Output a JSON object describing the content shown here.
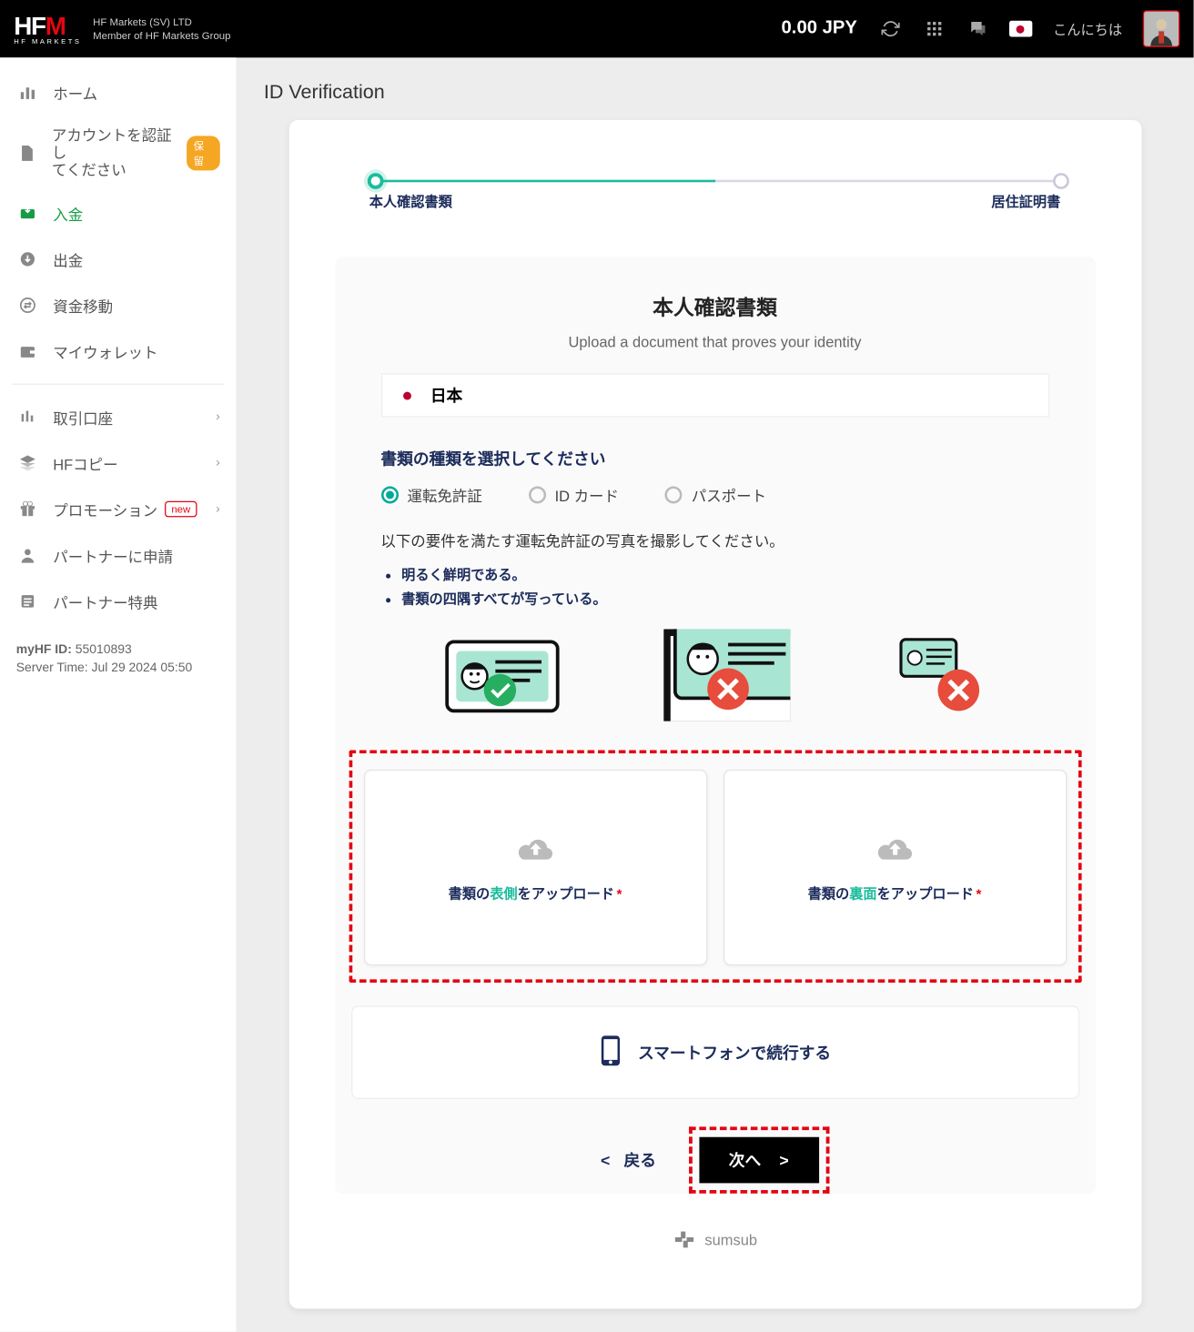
{
  "header": {
    "logo_sub": "HF MARKETS",
    "company_line1": "HF Markets (SV) LTD",
    "company_line2": "Member of HF Markets Group",
    "balance": "0.00 JPY",
    "greeting": "こんにちは"
  },
  "sidebar": {
    "home": "ホーム",
    "verify_line1": "アカウントを認証し",
    "verify_line2": "てください",
    "verify_badge": "保留",
    "deposit": "入金",
    "withdraw": "出金",
    "transfer": "資金移動",
    "wallet": "マイウォレット",
    "accounts": "取引口座",
    "hfcopy": "HFコピー",
    "promo": "プロモーション",
    "promo_badge": "new",
    "partner_apply": "パートナーに申請",
    "partner_perks": "パートナー特典",
    "id_label": "myHF ID:",
    "id_value": "55010893",
    "server_time": "Server Time: Jul 29 2024 05:50"
  },
  "main": {
    "page_title": "ID Verification",
    "step1": "本人確認書類",
    "step2": "居住証明書",
    "panel_title": "本人確認書類",
    "panel_sub": "Upload a document that proves your identity",
    "country": "日本",
    "doc_type_label": "書類の種類を選択してください",
    "opt_license": "運転免許証",
    "opt_idcard": "ID カード",
    "opt_passport": "パスポート",
    "instruction": "以下の要件を満たす運転免許証の写真を撮影してください。",
    "req1": "明るく鮮明である。",
    "req2": "書類の四隅すべてが写っている。",
    "upload_front_pre": "書類の",
    "upload_front_hi": "表側",
    "upload_front_post": "をアップロード",
    "upload_back_pre": "書類の",
    "upload_back_hi": "裏面",
    "upload_back_post": "をアップロード",
    "continue_mobile": "スマートフォンで続行する",
    "back": "戻る",
    "next": "次へ",
    "sumsub": "sumsub"
  }
}
